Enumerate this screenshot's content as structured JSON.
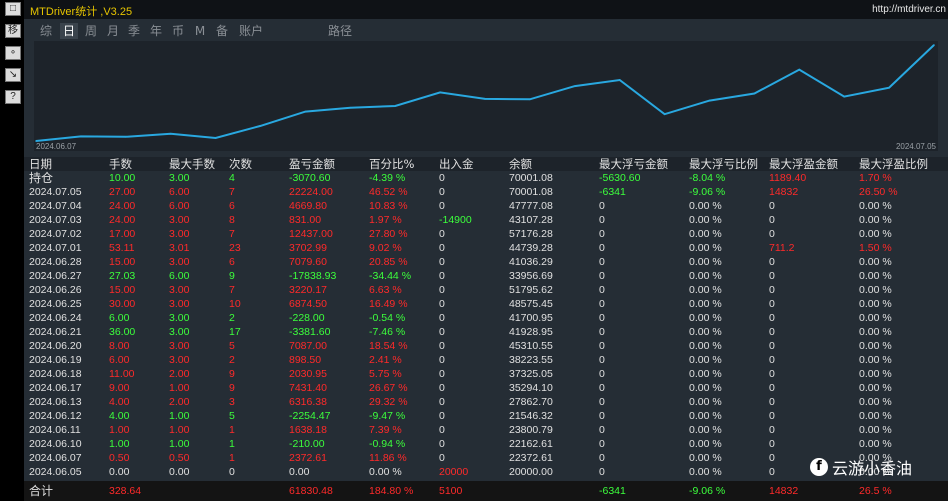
{
  "app_title": "MTDriver统计 ,V3.25",
  "url": "http://mtdriver.cn",
  "left_buttons": [
    "□",
    "移",
    "∘",
    "↘",
    "?"
  ],
  "tabs": [
    {
      "label": "综",
      "active": false
    },
    {
      "label": "日",
      "active": true
    },
    {
      "label": "周",
      "active": false
    },
    {
      "label": "月",
      "active": false
    },
    {
      "label": "季",
      "active": false
    },
    {
      "label": "年",
      "active": false
    },
    {
      "label": "币",
      "active": false
    },
    {
      "label": "M",
      "active": false
    },
    {
      "label": "备",
      "active": false
    },
    {
      "label": "账户",
      "active": false
    },
    {
      "label": "路径",
      "active": false
    }
  ],
  "chart_data": {
    "type": "line",
    "x_start_label": "2024.06.07",
    "x_end_label": "2024.07.05",
    "x": [
      "2024.06.05",
      "2024.06.07",
      "2024.06.10",
      "2024.06.11",
      "2024.06.12",
      "2024.06.13",
      "2024.06.17",
      "2024.06.18",
      "2024.06.19",
      "2024.06.20",
      "2024.06.21",
      "2024.06.24",
      "2024.06.25",
      "2024.06.26",
      "2024.06.27",
      "2024.06.28",
      "2024.07.01",
      "2024.07.02",
      "2024.07.03",
      "2024.07.04",
      "2024.07.05"
    ],
    "values": [
      20000,
      22372.61,
      22162.61,
      23800.79,
      21546.32,
      27862.7,
      35294.1,
      37325.05,
      38223.55,
      45310.55,
      41928.95,
      41700.95,
      48575.45,
      51795.62,
      33956.69,
      41036.29,
      44739.28,
      57176.28,
      43107.28,
      47777.08,
      70001.08
    ],
    "color": "#29a8e0"
  },
  "headers": [
    "日期",
    "手数",
    "最大手数",
    "次数",
    "盈亏金额",
    "百分比%",
    "出入金",
    "余额",
    "最大浮亏金额",
    "最大浮亏比例",
    "最大浮盈金额",
    "最大浮盈比例"
  ],
  "rows": [
    [
      "持仓",
      "10.00",
      "3.00",
      "4",
      "-3070.60",
      "-4.39 %",
      "0",
      "70001.08",
      "-5630.60",
      "-8.04 %",
      "1189.40",
      "1.70 %"
    ],
    [
      "2024.07.05",
      "27.00",
      "6.00",
      "7",
      "22224.00",
      "46.52 %",
      "0",
      "70001.08",
      "-6341",
      "-9.06 %",
      "14832",
      "26.50 %"
    ],
    [
      "2024.07.04",
      "24.00",
      "6.00",
      "6",
      "4669.80",
      "10.83 %",
      "0",
      "47777.08",
      "0",
      "0.00 %",
      "0",
      "0.00 %"
    ],
    [
      "2024.07.03",
      "24.00",
      "3.00",
      "8",
      "831.00",
      "1.97 %",
      "-14900",
      "43107.28",
      "0",
      "0.00 %",
      "0",
      "0.00 %"
    ],
    [
      "2024.07.02",
      "17.00",
      "3.00",
      "7",
      "12437.00",
      "27.80 %",
      "0",
      "57176.28",
      "0",
      "0.00 %",
      "0",
      "0.00 %"
    ],
    [
      "2024.07.01",
      "53.11",
      "3.01",
      "23",
      "3702.99",
      "9.02 %",
      "0",
      "44739.28",
      "0",
      "0.00 %",
      "711.2",
      "1.50 %"
    ],
    [
      "2024.06.28",
      "15.00",
      "3.00",
      "6",
      "7079.60",
      "20.85 %",
      "0",
      "41036.29",
      "0",
      "0.00 %",
      "0",
      "0.00 %"
    ],
    [
      "2024.06.27",
      "27.03",
      "6.00",
      "9",
      "-17838.93",
      "-34.44 %",
      "0",
      "33956.69",
      "0",
      "0.00 %",
      "0",
      "0.00 %"
    ],
    [
      "2024.06.26",
      "15.00",
      "3.00",
      "7",
      "3220.17",
      "6.63 %",
      "0",
      "51795.62",
      "0",
      "0.00 %",
      "0",
      "0.00 %"
    ],
    [
      "2024.06.25",
      "30.00",
      "3.00",
      "10",
      "6874.50",
      "16.49 %",
      "0",
      "48575.45",
      "0",
      "0.00 %",
      "0",
      "0.00 %"
    ],
    [
      "2024.06.24",
      "6.00",
      "3.00",
      "2",
      "-228.00",
      "-0.54 %",
      "0",
      "41700.95",
      "0",
      "0.00 %",
      "0",
      "0.00 %"
    ],
    [
      "2024.06.21",
      "36.00",
      "3.00",
      "17",
      "-3381.60",
      "-7.46 %",
      "0",
      "41928.95",
      "0",
      "0.00 %",
      "0",
      "0.00 %"
    ],
    [
      "2024.06.20",
      "8.00",
      "3.00",
      "5",
      "7087.00",
      "18.54 %",
      "0",
      "45310.55",
      "0",
      "0.00 %",
      "0",
      "0.00 %"
    ],
    [
      "2024.06.19",
      "6.00",
      "3.00",
      "2",
      "898.50",
      "2.41 %",
      "0",
      "38223.55",
      "0",
      "0.00 %",
      "0",
      "0.00 %"
    ],
    [
      "2024.06.18",
      "11.00",
      "2.00",
      "9",
      "2030.95",
      "5.75 %",
      "0",
      "37325.05",
      "0",
      "0.00 %",
      "0",
      "0.00 %"
    ],
    [
      "2024.06.17",
      "9.00",
      "1.00",
      "9",
      "7431.40",
      "26.67 %",
      "0",
      "35294.10",
      "0",
      "0.00 %",
      "0",
      "0.00 %"
    ],
    [
      "2024.06.13",
      "4.00",
      "2.00",
      "3",
      "6316.38",
      "29.32 %",
      "0",
      "27862.70",
      "0",
      "0.00 %",
      "0",
      "0.00 %"
    ],
    [
      "2024.06.12",
      "4.00",
      "1.00",
      "5",
      "-2254.47",
      "-9.47 %",
      "0",
      "21546.32",
      "0",
      "0.00 %",
      "0",
      "0.00 %"
    ],
    [
      "2024.06.11",
      "1.00",
      "1.00",
      "1",
      "1638.18",
      "7.39 %",
      "0",
      "23800.79",
      "0",
      "0.00 %",
      "0",
      "0.00 %"
    ],
    [
      "2024.06.10",
      "1.00",
      "1.00",
      "1",
      "-210.00",
      "-0.94 %",
      "0",
      "22162.61",
      "0",
      "0.00 %",
      "0",
      "0.00 %"
    ],
    [
      "2024.06.07",
      "0.50",
      "0.50",
      "1",
      "2372.61",
      "11.86 %",
      "0",
      "22372.61",
      "0",
      "0.00 %",
      "0",
      "0.00 %"
    ],
    [
      "2024.06.05",
      "0.00",
      "0.00",
      "0",
      "0.00",
      "0.00 %",
      "20000",
      "20000.00",
      "0",
      "0.00 %",
      "0",
      "0.00 %"
    ]
  ],
  "row_colors": [
    [
      "w",
      "g",
      "g",
      "g",
      "g",
      "g",
      "w",
      "w",
      "g",
      "g",
      "r",
      "r"
    ],
    [
      "w",
      "r",
      "r",
      "r",
      "r",
      "r",
      "w",
      "w",
      "g",
      "g",
      "r",
      "r"
    ],
    [
      "w",
      "r",
      "r",
      "r",
      "r",
      "r",
      "w",
      "w",
      "w",
      "w",
      "w",
      "w"
    ],
    [
      "w",
      "r",
      "r",
      "r",
      "r",
      "r",
      "g",
      "w",
      "w",
      "w",
      "w",
      "w"
    ],
    [
      "w",
      "r",
      "r",
      "r",
      "r",
      "r",
      "w",
      "w",
      "w",
      "w",
      "w",
      "w"
    ],
    [
      "w",
      "r",
      "r",
      "r",
      "r",
      "r",
      "w",
      "w",
      "w",
      "w",
      "r",
      "r"
    ],
    [
      "w",
      "r",
      "r",
      "r",
      "r",
      "r",
      "w",
      "w",
      "w",
      "w",
      "w",
      "w"
    ],
    [
      "w",
      "g",
      "g",
      "g",
      "g",
      "g",
      "w",
      "w",
      "w",
      "w",
      "w",
      "w"
    ],
    [
      "w",
      "r",
      "r",
      "r",
      "r",
      "r",
      "w",
      "w",
      "w",
      "w",
      "w",
      "w"
    ],
    [
      "w",
      "r",
      "r",
      "r",
      "r",
      "r",
      "w",
      "w",
      "w",
      "w",
      "w",
      "w"
    ],
    [
      "w",
      "g",
      "g",
      "g",
      "g",
      "g",
      "w",
      "w",
      "w",
      "w",
      "w",
      "w"
    ],
    [
      "w",
      "g",
      "g",
      "g",
      "g",
      "g",
      "w",
      "w",
      "w",
      "w",
      "w",
      "w"
    ],
    [
      "w",
      "r",
      "r",
      "r",
      "r",
      "r",
      "w",
      "w",
      "w",
      "w",
      "w",
      "w"
    ],
    [
      "w",
      "r",
      "r",
      "r",
      "r",
      "r",
      "w",
      "w",
      "w",
      "w",
      "w",
      "w"
    ],
    [
      "w",
      "r",
      "r",
      "r",
      "r",
      "r",
      "w",
      "w",
      "w",
      "w",
      "w",
      "w"
    ],
    [
      "w",
      "r",
      "r",
      "r",
      "r",
      "r",
      "w",
      "w",
      "w",
      "w",
      "w",
      "w"
    ],
    [
      "w",
      "r",
      "r",
      "r",
      "r",
      "r",
      "w",
      "w",
      "w",
      "w",
      "w",
      "w"
    ],
    [
      "w",
      "g",
      "g",
      "g",
      "g",
      "g",
      "w",
      "w",
      "w",
      "w",
      "w",
      "w"
    ],
    [
      "w",
      "r",
      "r",
      "r",
      "r",
      "r",
      "w",
      "w",
      "w",
      "w",
      "w",
      "w"
    ],
    [
      "w",
      "g",
      "g",
      "g",
      "g",
      "g",
      "w",
      "w",
      "w",
      "w",
      "w",
      "w"
    ],
    [
      "w",
      "r",
      "r",
      "r",
      "r",
      "r",
      "w",
      "w",
      "w",
      "w",
      "w",
      "w"
    ],
    [
      "w",
      "w",
      "w",
      "w",
      "w",
      "w",
      "r",
      "w",
      "w",
      "w",
      "w",
      "w"
    ]
  ],
  "footer": [
    "合计",
    "328.64",
    "",
    "",
    "61830.48",
    "184.80 %",
    "5100",
    "",
    "-6341",
    "-9.06 %",
    "14832",
    "26.5 %"
  ],
  "footer_colors": [
    "w",
    "r",
    "w",
    "w",
    "r",
    "r",
    "r",
    "w",
    "g",
    "g",
    "r",
    "r"
  ],
  "watermark": "云游小香油",
  "colors": {
    "red": "#ff2a2a",
    "green": "#3cff3c",
    "line": "#29a8e0",
    "title": "#e6c400"
  }
}
